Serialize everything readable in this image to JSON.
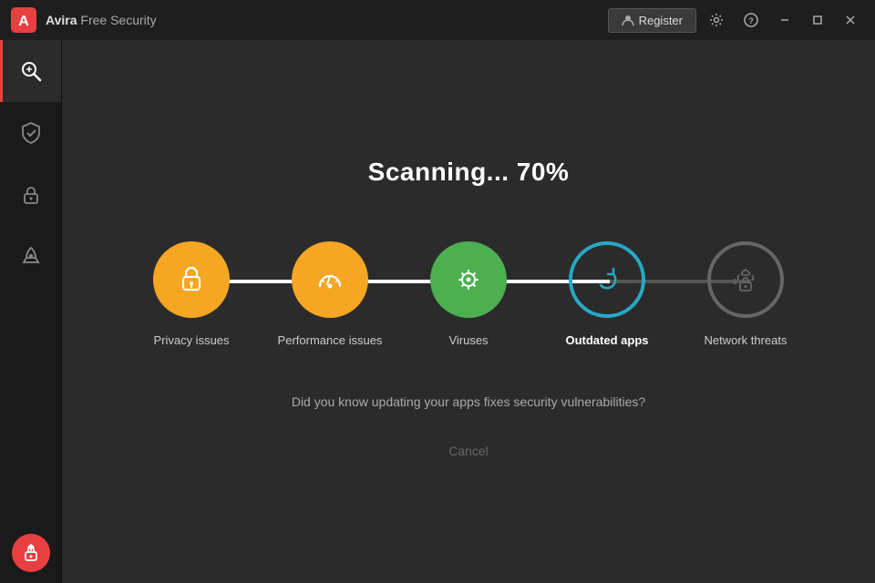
{
  "titleBar": {
    "appName": "Avira",
    "appNameSuffix": " Free Security",
    "registerLabel": "Register",
    "settingsTooltip": "Settings",
    "helpTooltip": "Help",
    "minimizeTooltip": "Minimize",
    "maximizeTooltip": "Maximize",
    "closeTooltip": "Close"
  },
  "sidebar": {
    "items": [
      {
        "id": "scan",
        "label": "Scan",
        "icon": "🔍",
        "active": true
      },
      {
        "id": "protection",
        "label": "Protection",
        "icon": "✔",
        "active": false
      },
      {
        "id": "privacy",
        "label": "Privacy",
        "icon": "🔒",
        "active": false
      },
      {
        "id": "performance",
        "label": "Performance",
        "icon": "🚀",
        "active": false
      }
    ],
    "updateIcon": "⬆"
  },
  "content": {
    "scanTitle": "Scanning... 70%",
    "steps": [
      {
        "id": "privacy",
        "label": "Privacy issues",
        "state": "orange",
        "icon": "privacy"
      },
      {
        "id": "performance",
        "label": "Performance issues",
        "state": "orange",
        "icon": "gauge"
      },
      {
        "id": "viruses",
        "label": "Viruses",
        "state": "green",
        "icon": "virus"
      },
      {
        "id": "outdated",
        "label": "Outdated apps",
        "state": "teal-outline",
        "icon": "refresh",
        "bold": true
      },
      {
        "id": "network",
        "label": "Network threats",
        "state": "gray-outline",
        "icon": "lock"
      }
    ],
    "progressFillPercent": 75,
    "hintText": "Did you know updating your apps fixes security vulnerabilities?",
    "cancelLabel": "Cancel"
  }
}
